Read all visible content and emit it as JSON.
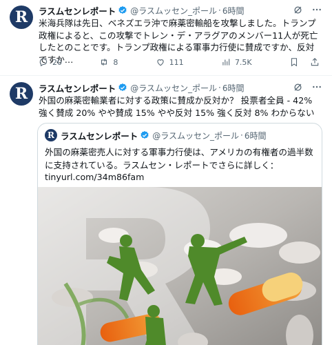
{
  "colors": {
    "brand_blue": "#1e3a66",
    "verified_blue": "#1d9bf0",
    "secondary_text": "#536471",
    "border": "#cfd9de"
  },
  "tweets": [
    {
      "avatar_letter": "R",
      "name": "ラスムセンレポート",
      "handle": "@ラスムッセン_ポール",
      "sep": "·",
      "time": "6時間",
      "text": "米海兵隊は先日、ベネズエラ沖で麻薬密輸船を攻撃しました。トランプ政権によると、この攻撃でトレン・デ・アラグアのメンバー11人が死亡したとのことです。トランプ政権による軍事力行使に賛成ですか、反対ですか…",
      "metrics": {
        "replies": "20",
        "reposts": "8",
        "likes": "111",
        "views": "7.5K"
      },
      "header_icons": [
        "grok-icon",
        "more-icon"
      ],
      "action_icons": [
        "reply-icon",
        "repost-icon",
        "like-icon",
        "views-icon",
        "bookmark-icon",
        "share-icon"
      ]
    },
    {
      "avatar_letter": "R",
      "name": "ラスムセンレポート",
      "handle": "@ラスムッセン_ポール",
      "sep": "·",
      "time": "6時間",
      "text": "外国の麻薬密輸業者に対する政策に賛成か反対か？ 投票者全員 - 42% 強く賛成 20% やや賛成 15% やや反対 15% 強く反対 8% わからない",
      "quote": {
        "avatar_letter": "R",
        "name": "ラスムセンレポート",
        "handle": "@ラスムッセン_ポール",
        "sep": "·",
        "time": "6時間",
        "text": "外国の麻薬密売人に対する軍事力行使は、アメリカの有権者の過半数に支持されている。ラスムセン・レポートでさらに詳しく：",
        "link": "tinyurl.com/34m86fam"
      }
    }
  ]
}
